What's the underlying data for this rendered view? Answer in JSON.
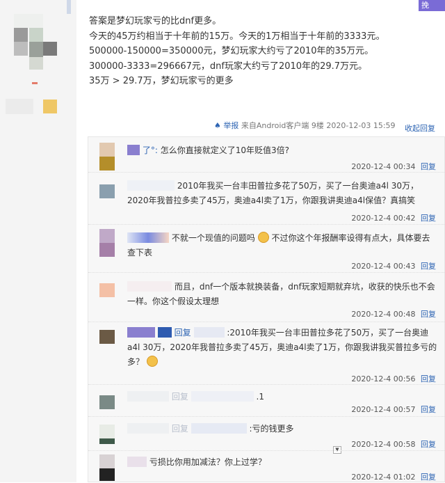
{
  "top_button": "挽",
  "answer_lines": [
    "答案是梦幻玩家亏的比dnf更多。",
    "今天的45万约相当于十年前的15万。今天的1万相当于十年前的3333元。",
    "500000-150000=350000元，梦幻玩家大约亏了2010年的35万元。",
    "300000-3333=296667元，dnf玩家大约亏了2010年的29.7万元。",
    "35万 > 29.7万，梦幻玩家亏的更多"
  ],
  "post_meta": {
    "report": "举报",
    "source": "来自Android客户端",
    "floor": "9楼",
    "time": "2020-12-03 15:59",
    "collapse": "收起回复"
  },
  "comments": [
    {
      "name": "了°:",
      "text": "怎么你直接就定义了10年贬值3倍?",
      "time": "2020-12-4 00:34",
      "reply": "回复"
    },
    {
      "name": "",
      "text": "2010年我买一台丰田普拉多花了50万，买了一台奥迪a4l 30万，2020年我普拉多卖了45万，奥迪a4l卖了1万，你跟我讲奥迪a4l保值？真搞笑",
      "time": "2020-12-4 00:42",
      "reply": "回复"
    },
    {
      "name": "",
      "text": "不就一个现值的问题吗",
      "text2": "不过你这个年报酬率设得有点大，具体要去查下表",
      "time": "2020-12-4 00:43",
      "reply": "回复"
    },
    {
      "name": "",
      "text": "而且，dnf一个版本就换装备，dnf玩家短期就弃坑，收获的快乐也不会一样。你这个假设太理想",
      "time": "2020-12-4 00:48",
      "reply": "回复"
    },
    {
      "name": "回复",
      "text": ":2010年我买一台丰田普拉多花了50万，买了一台奥迪a4l 30万，2020年我普拉多卖了45万，奥迪a4l卖了1万，你跟我讲我买普拉多亏的多？",
      "time": "2020-12-4 00:56",
      "reply": "回复"
    },
    {
      "name": "回复",
      "text": ".1",
      "time": "2020-12-4 00:57",
      "reply": "回复"
    },
    {
      "name": "回复",
      "text": ":亏的钱更多",
      "time": "2020-12-4 00:58",
      "reply": "回复"
    },
    {
      "name": "",
      "text": "亏损比你用加减法？你上过学？",
      "time": "2020-12-4 01:02",
      "reply": "回复"
    }
  ]
}
